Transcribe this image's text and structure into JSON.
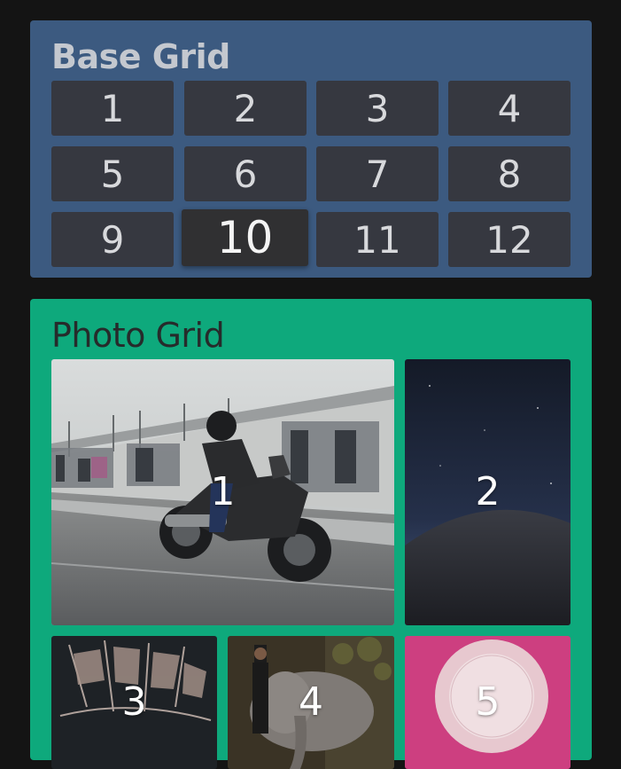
{
  "base_grid": {
    "title": "Base Grid",
    "cells": [
      "1",
      "2",
      "3",
      "4",
      "5",
      "6",
      "7",
      "8",
      "9",
      "10",
      "11",
      "12"
    ],
    "active_cell": "10"
  },
  "photo_grid": {
    "title": "Photo Grid",
    "photos": [
      {
        "label": "1",
        "subject": "motorcycle-rider"
      },
      {
        "label": "2",
        "subject": "night-sky-dune"
      },
      {
        "label": "3",
        "subject": "ship-sketch"
      },
      {
        "label": "4",
        "subject": "person-with-elephant"
      },
      {
        "label": "5",
        "subject": "plate-on-pink"
      }
    ]
  },
  "colors": {
    "page_bg": "#141414",
    "base_panel_bg": "#3c5a80",
    "photo_panel_bg": "#0ea97c",
    "cell_bg": "#363840"
  }
}
